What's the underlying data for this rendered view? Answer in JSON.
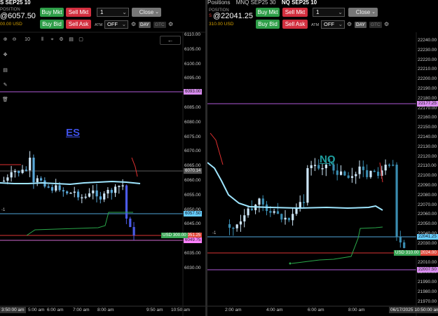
{
  "left": {
    "tabs": [
      {
        "label": "S SEP25 10",
        "active": true
      }
    ],
    "position_label": "POSITION",
    "position_price": "@6057.50",
    "position_usd": "00.00 USD",
    "buttons": {
      "buy_mkt": "Buy Mkt",
      "sell_mkt": "Sell Mkt",
      "buy_bid": "Buy Bid",
      "sell_ask": "Sell Ask",
      "close": "Close"
    },
    "qty": "1",
    "atm_label": "ATM",
    "atm_value": "OFF",
    "tif": {
      "day": "DAY",
      "gtc": "GTC"
    },
    "tools": [
      "zoom-in",
      "zoom-out",
      "10",
      "bars",
      "crosshair",
      "settings",
      "table"
    ],
    "ticker": "ES",
    "ticker_color": "#3f51e8",
    "price_axis": [
      "6110.00",
      "6105.00",
      "6100.00",
      "6095.00",
      "6090.00",
      "6085.00",
      "6080.00",
      "6075.00",
      "6070.00",
      "6065.00",
      "6060.00",
      "6055.00",
      "6050.00",
      "6045.00",
      "6040.00",
      "6035.00",
      "6030.00"
    ],
    "badges": {
      "purple": "6093.00",
      "grey": "6070.14",
      "blue": "6057.50",
      "red": "6051.25",
      "pink": "6049.75",
      "usd": "USD 300.00"
    },
    "time_badge": "3:50:00 am",
    "time_labels": [
      "5:00 am",
      "6:00 am",
      "7:00 am",
      "8:00 am",
      "9:50 am",
      "10:50 am"
    ],
    "marker": "-1"
  },
  "right": {
    "tabs": [
      {
        "label": "Positions",
        "active": false
      },
      {
        "label": "MNQ SEP25 30",
        "active": false
      },
      {
        "label": "NQ SEP25 10",
        "active": true
      }
    ],
    "position_label": "POSITION",
    "position_price": "@22041.25",
    "position_usd": "310.00 USD",
    "red_mark": "S",
    "buttons": {
      "buy_mkt": "Buy Mkt",
      "sell_mkt": "Sell Mkt",
      "buy_bid": "Buy Bid",
      "sell_ask": "Sell Ask",
      "close": "Close"
    },
    "qty": "1",
    "atm_label": "ATM",
    "atm_value": "OFF",
    "tif": {
      "day": "DAY",
      "gtc": "GTC"
    },
    "ticker": "NQ",
    "ticker_color": "#1e9e9e",
    "price_axis": [
      "22240.00",
      "22230.00",
      "22220.00",
      "22210.00",
      "22200.00",
      "22190.00",
      "22180.00",
      "22170.00",
      "22160.00",
      "22150.00",
      "22140.00",
      "22130.00",
      "22120.00",
      "22110.00",
      "22100.00",
      "22090.00",
      "22080.00",
      "22070.00",
      "22060.00",
      "22050.00",
      "22040.00",
      "22030.00",
      "22020.00",
      "22010.00",
      "22000.00",
      "21990.00",
      "21980.00",
      "21970.00"
    ],
    "badges": {
      "purple_top": "22177.25",
      "blue": "22041.25",
      "red": "22024.00",
      "purple_bottom": "22007.50",
      "usd": "USD 310.00"
    },
    "time_badge": "06/17/2025 10:50:00 am",
    "time_labels": [
      "2:00 am",
      "4:00 am",
      "6:00 am",
      "8:00 am"
    ],
    "marker": "-1"
  }
}
